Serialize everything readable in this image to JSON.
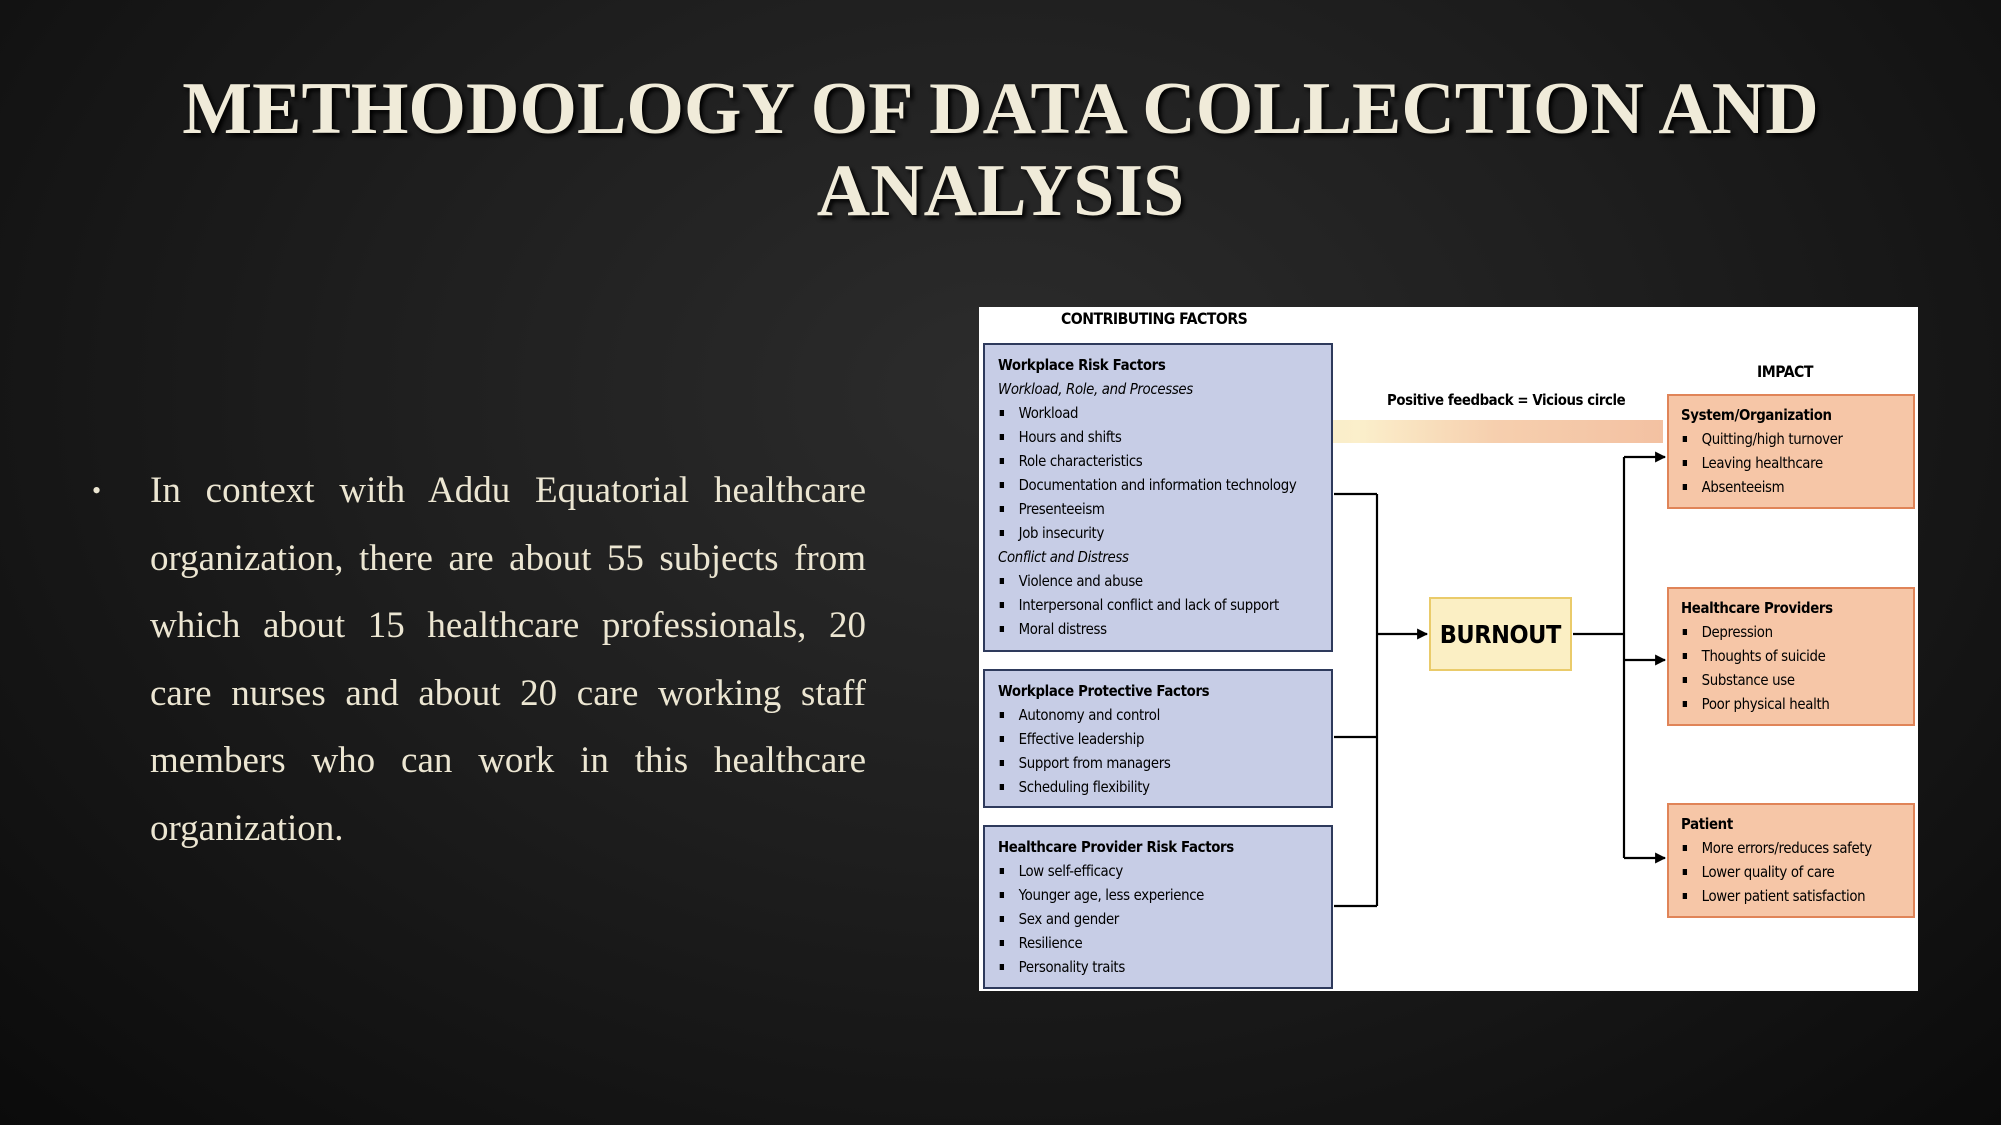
{
  "slide": {
    "title_line1": "METHODOLOGY OF DATA COLLECTION AND",
    "title_line2": "ANALYSIS",
    "bullets": [
      {
        "marker": "•",
        "text": "In context with Addu Equatorial healthcare organization, there are about 55 subjects from which about 15 healthcare professionals, 20 care nurses and about 20 care working staff members who can work in this healthcare organization."
      }
    ]
  },
  "diagram": {
    "contributing_heading": "CONTRIBUTING FACTORS",
    "impact_heading": "IMPACT",
    "feedback_label": "Positive feedback = Vicious circle",
    "central_node": "BURNOUT",
    "colors": {
      "factor_fill": "#c7cde6",
      "factor_border": "#2e3a5c",
      "impact_fill": "#f6c6a7",
      "impact_border": "#e08458",
      "burnout_fill": "#fbefc4",
      "burnout_border": "#eacb6a"
    },
    "factors": [
      {
        "title": "Workplace Risk Factors",
        "groups": [
          {
            "subtitle": "Workload, Role, and Processes",
            "items": [
              "Workload",
              "Hours and shifts",
              "Role characteristics",
              "Documentation and information technology",
              "Presenteeism",
              "Job insecurity"
            ]
          },
          {
            "subtitle": "Conflict and Distress",
            "items": [
              "Violence and abuse",
              "Interpersonal conflict and lack of support",
              "Moral distress"
            ]
          }
        ]
      },
      {
        "title": "Workplace Protective Factors",
        "groups": [
          {
            "subtitle": "",
            "items": [
              "Autonomy and control",
              "Effective leadership",
              "Support from managers",
              "Scheduling flexibility"
            ]
          }
        ]
      },
      {
        "title": "Healthcare Provider Risk Factors",
        "groups": [
          {
            "subtitle": "",
            "items": [
              "Low self-efficacy",
              "Younger age, less experience",
              "Sex and gender",
              "Resilience",
              "Personality traits"
            ]
          }
        ]
      }
    ],
    "impacts": [
      {
        "title": "System/Organization",
        "items": [
          "Quitting/high turnover",
          "Leaving healthcare",
          "Absenteeism"
        ]
      },
      {
        "title": "Healthcare Providers",
        "items": [
          "Depression",
          "Thoughts of suicide",
          "Substance use",
          "Poor physical health"
        ]
      },
      {
        "title": "Patient",
        "items": [
          "More errors/reduces safety",
          "Lower quality of care",
          "Lower patient satisfaction"
        ]
      }
    ]
  }
}
